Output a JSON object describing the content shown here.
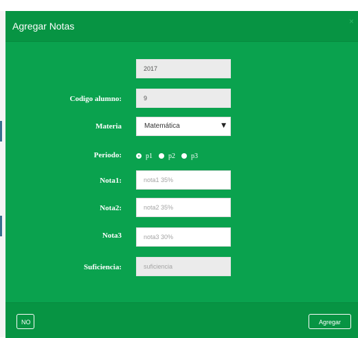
{
  "dialog": {
    "title": "Agregar Notas",
    "close_label": "×"
  },
  "form": {
    "year": {
      "value": "2017"
    },
    "codigo_alumno": {
      "label": "Codigo alumno:",
      "value": "9"
    },
    "materia": {
      "label": "Materia",
      "selected": "Matemática"
    },
    "periodo": {
      "label": "Periodo:",
      "options": [
        "p1",
        "p2",
        "p3"
      ],
      "selected": "p1"
    },
    "nota1": {
      "label": "Nota1:",
      "placeholder": "nota1 35%"
    },
    "nota2": {
      "label": "Nota2:",
      "placeholder": "nota2 35%"
    },
    "nota3": {
      "label": "Nota3",
      "placeholder": "nota3 30%"
    },
    "suficiencia": {
      "label": "Suficiencia:",
      "placeholder": "suficiencia"
    }
  },
  "footer": {
    "no_label": "NO",
    "agregar_label": "Agregar"
  },
  "colors": {
    "body_green": "#0aa24e",
    "header_green": "#079443"
  }
}
